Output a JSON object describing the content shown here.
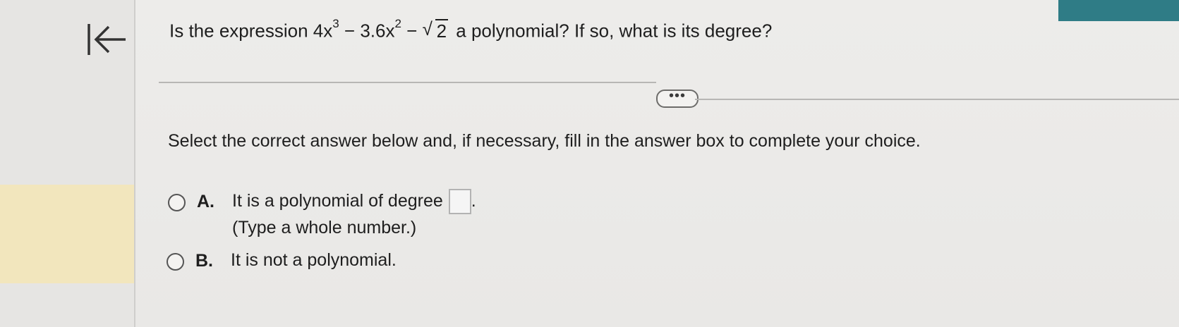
{
  "question": {
    "prefix": "Is the expression 4x",
    "exp1": "3",
    "mid": " − 3.6x",
    "exp2": "2",
    "minus": " − ",
    "radicand": "2",
    "suffix": " a polynomial? If so, what is its degree?"
  },
  "more_button": {
    "label": "•••"
  },
  "instruction": "Select the correct answer below and, if necessary, fill in the answer box to complete your choice.",
  "options": [
    {
      "letter": "A.",
      "line1": "It is a polynomial of degree",
      "after_box": ".",
      "line2": "(Type a whole number.)",
      "answer_value": ""
    },
    {
      "letter": "B.",
      "line1": "It is not a polynomial."
    }
  ],
  "colors": {
    "accent_strip": "#2f7c86",
    "left_highlight": "#f2e6bd"
  },
  "icons": {
    "back": "first-page-arrow-icon"
  }
}
